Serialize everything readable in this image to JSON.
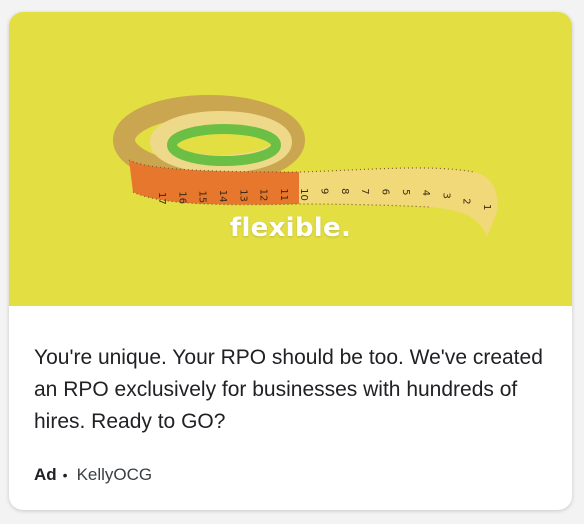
{
  "ad": {
    "image_alt": "tape measure",
    "overlay_text": "flexible.",
    "body_text": "You're unique. Your RPO should be too. We've created an RPO exclusively for businesses with hundreds of hires. Ready to GO?",
    "label": "Ad",
    "separator": "•",
    "advertiser": "KellyOCG",
    "colors": {
      "background": "#e3de42",
      "tape_orange": "#e8772e",
      "tape_yellow": "#f1d878",
      "tape_green": "#6cbf45"
    }
  },
  "tape_numbers": [
    "17",
    "16",
    "15",
    "14",
    "13",
    "12",
    "11",
    "10",
    "9",
    "8",
    "7",
    "6",
    "5",
    "4",
    "3",
    "2",
    "1"
  ]
}
